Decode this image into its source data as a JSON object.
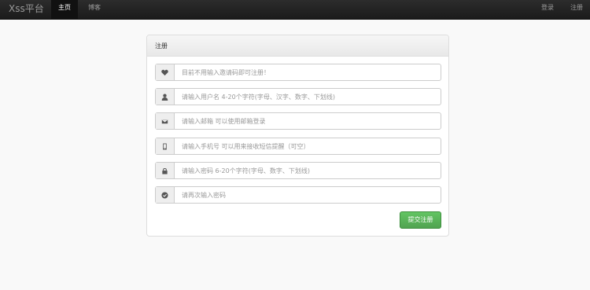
{
  "navbar": {
    "brand": "Xss平台",
    "items": [
      {
        "label": "主页",
        "active": true
      },
      {
        "label": "博客",
        "active": false
      }
    ],
    "right_items": [
      {
        "label": "登录"
      },
      {
        "label": "注册"
      }
    ]
  },
  "panel": {
    "title": "注册",
    "fields": [
      {
        "icon": "heart-icon",
        "placeholder": "目前不用输入邀请码即可注册！"
      },
      {
        "icon": "user-icon",
        "placeholder": "请输入用户名 4-20个字符(字母、汉字、数字、下划线)"
      },
      {
        "icon": "envelope-icon",
        "placeholder": "请输入邮箱 可以使用邮箱登录"
      },
      {
        "icon": "phone-icon",
        "placeholder": "请输入手机号 可以用来接收短信提醒（可空）"
      },
      {
        "icon": "lock-icon",
        "placeholder": "请输入密码 6-20个字符(字母、数字、下划线)"
      },
      {
        "icon": "check-circle-icon",
        "placeholder": "请再次输入密码"
      }
    ],
    "submit_label": "提交注册"
  },
  "colors": {
    "navbar": "#1b1b1b",
    "submit": "#51a351",
    "page_bg": "#f9f9f9"
  }
}
